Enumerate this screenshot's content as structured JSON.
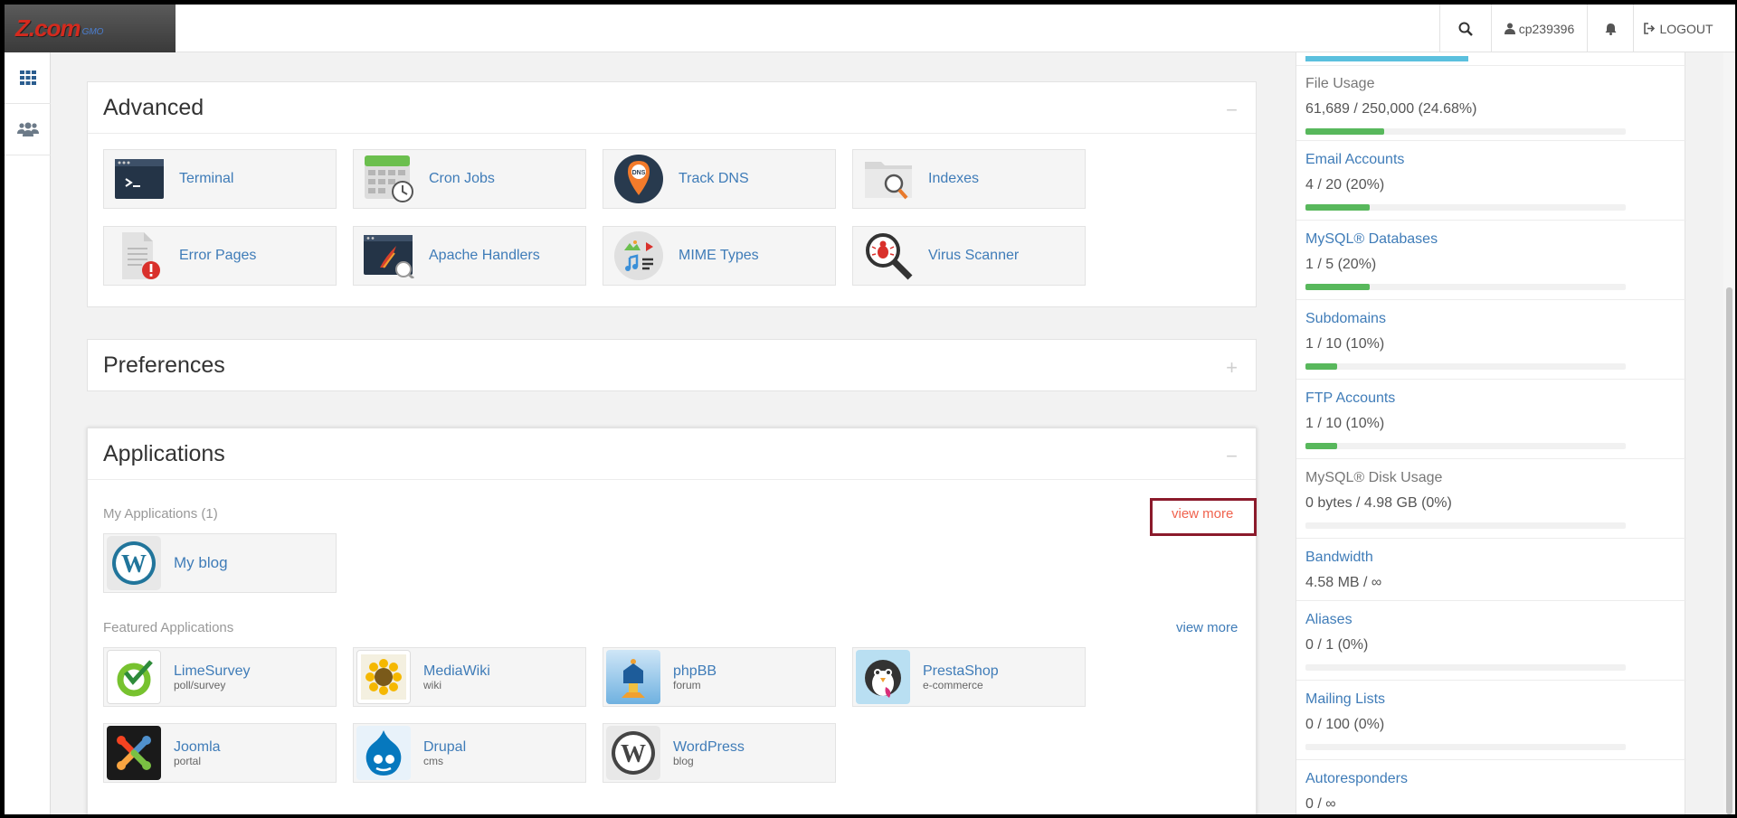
{
  "brand": {
    "name": "Z.com",
    "sub": "GMO"
  },
  "topbar": {
    "user": "cp239396",
    "logout": "LOGOUT"
  },
  "advanced": {
    "title": "Advanced",
    "toggle": "−",
    "items": [
      {
        "label": "Terminal",
        "icon": "terminal-icon"
      },
      {
        "label": "Cron Jobs",
        "icon": "calendar-clock-icon"
      },
      {
        "label": "Track DNS",
        "icon": "dns-pin-icon"
      },
      {
        "label": "Indexes",
        "icon": "folder-search-icon"
      },
      {
        "label": "Error Pages",
        "icon": "document-error-icon"
      },
      {
        "label": "Apache Handlers",
        "icon": "apache-handler-icon"
      },
      {
        "label": "MIME Types",
        "icon": "media-types-icon"
      },
      {
        "label": "Virus Scanner",
        "icon": "bug-magnifier-icon"
      }
    ]
  },
  "preferences": {
    "title": "Preferences",
    "toggle": "+"
  },
  "applications": {
    "title": "Applications",
    "toggle": "−",
    "my_label": "My Applications (1)",
    "my_view_more": "view more",
    "my_apps": [
      {
        "name": "My blog",
        "icon": "wordpress-icon"
      }
    ],
    "featured_label": "Featured Applications",
    "featured_view_more": "view more",
    "featured": [
      {
        "name": "LimeSurvey",
        "desc": "poll/survey",
        "icon": "limesurvey-icon"
      },
      {
        "name": "MediaWiki",
        "desc": "wiki",
        "icon": "mediawiki-icon"
      },
      {
        "name": "phpBB",
        "desc": "forum",
        "icon": "phpbb-icon"
      },
      {
        "name": "PrestaShop",
        "desc": "e-commerce",
        "icon": "prestashop-icon"
      },
      {
        "name": "Joomla",
        "desc": "portal",
        "icon": "joomla-icon"
      },
      {
        "name": "Drupal",
        "desc": "cms",
        "icon": "drupal-icon"
      },
      {
        "name": "WordPress",
        "desc": "blog",
        "icon": "wordpress-icon"
      }
    ]
  },
  "stats": [
    {
      "title": "File Usage",
      "value": "61,689 / 250,000   (24.68%)",
      "pct": 0.2468,
      "link": false
    },
    {
      "title": "Email Accounts",
      "value": "4 / 20   (20%)",
      "pct": 0.2,
      "link": true
    },
    {
      "title": "MySQL® Databases",
      "value": "1 / 5   (20%)",
      "pct": 0.2,
      "link": true
    },
    {
      "title": "Subdomains",
      "value": "1 / 10   (10%)",
      "pct": 0.1,
      "link": true
    },
    {
      "title": "FTP Accounts",
      "value": "1 / 10   (10%)",
      "pct": 0.1,
      "link": true
    },
    {
      "title": "MySQL® Disk Usage",
      "value": "0 bytes / 4.98 GB   (0%)",
      "pct": 0,
      "link": false
    },
    {
      "title": "Bandwidth",
      "value": "4.58 MB / ∞",
      "pct": null,
      "link": true
    },
    {
      "title": "Aliases",
      "value": "0 / 1   (0%)",
      "pct": 0,
      "link": true
    },
    {
      "title": "Mailing Lists",
      "value": "0 / 100   (0%)",
      "pct": 0,
      "link": true
    },
    {
      "title": "Autoresponders",
      "value": "0 / ∞",
      "pct": null,
      "link": true
    }
  ],
  "colors": {
    "link": "#3f7cb8",
    "accent": "#58b85c",
    "highlight": "#8b1a2b",
    "viewmore_red": "#f0624d"
  }
}
